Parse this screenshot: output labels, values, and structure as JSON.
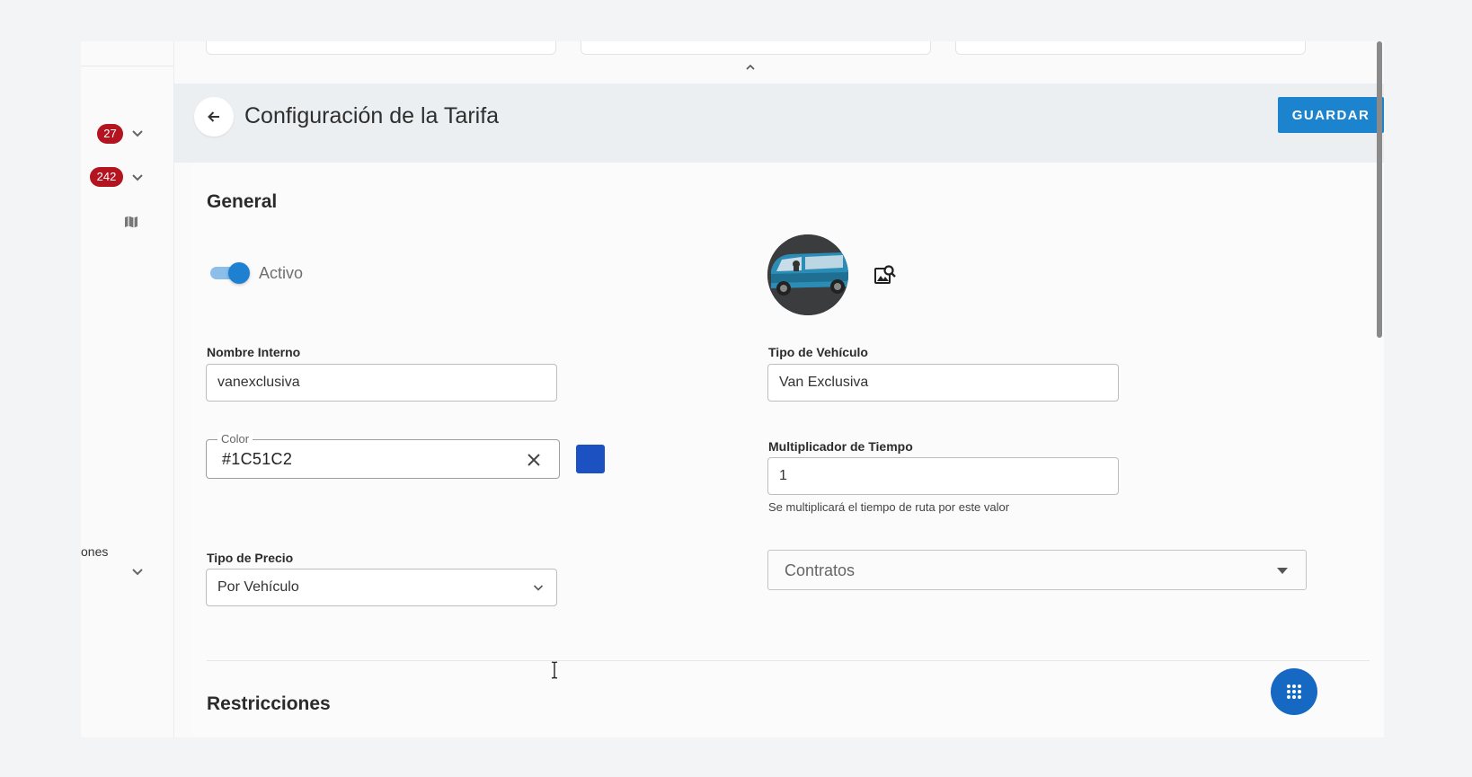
{
  "sidebar": {
    "badges": [
      "27",
      "242"
    ],
    "partial_text": "ones"
  },
  "header": {
    "title": "Configuración de la Tarifa",
    "save_label": "GUARDAR"
  },
  "general": {
    "section_title": "General",
    "active_toggle": {
      "label": "Activo",
      "checked": true
    },
    "internal_name": {
      "label": "Nombre Interno",
      "value": "vanexclusiva"
    },
    "color": {
      "legend": "Color",
      "value": "#1C51C2",
      "swatch": "#1c51c2"
    },
    "price_type": {
      "label": "Tipo de Precio",
      "value": "Por Vehículo"
    },
    "vehicle_type": {
      "label": "Tipo de Vehículo",
      "value": "Van Exclusiva"
    },
    "time_multiplier": {
      "label": "Multiplicador de Tiempo",
      "value": "1",
      "helper": "Se multiplicará el tiempo de ruta por este valor"
    },
    "contracts": {
      "placeholder": "Contratos"
    }
  },
  "restrictions": {
    "section_title": "Restricciones"
  },
  "colors": {
    "primary": "#1c83cf",
    "badge": "#b3141f",
    "fab": "#1669c2"
  },
  "icons": [
    "chevron-down-icon",
    "map-icon",
    "back-arrow-icon",
    "clear-icon",
    "image-search-icon",
    "apps-grid-icon",
    "caret-up-icon"
  ]
}
